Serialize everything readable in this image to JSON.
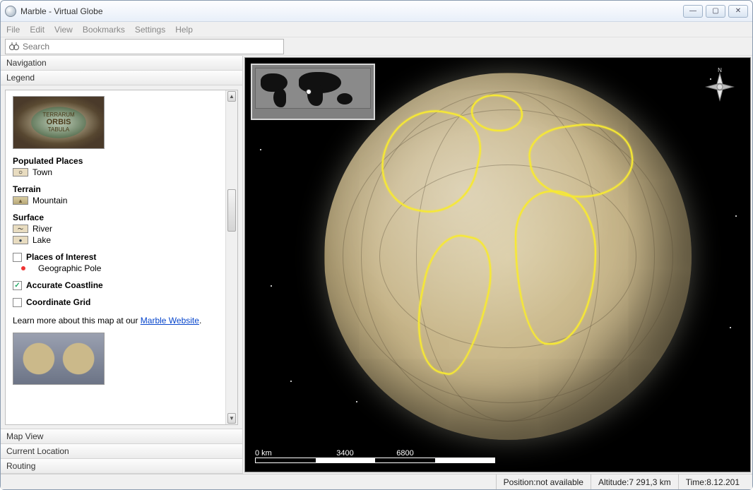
{
  "window": {
    "title": "Marble - Virtual Globe"
  },
  "menu": {
    "file": "File",
    "edit": "Edit",
    "view": "View",
    "bookmarks": "Bookmarks",
    "settings": "Settings",
    "help": "Help"
  },
  "search": {
    "placeholder": "Search"
  },
  "sidebar": {
    "tabs": {
      "navigation": "Navigation",
      "legend": "Legend",
      "mapview": "Map View",
      "currentlocation": "Current Location",
      "routing": "Routing"
    }
  },
  "legend": {
    "cartouche": {
      "line1": "TERRARUM",
      "line2": "ORBIS",
      "line3": "TABULA"
    },
    "sections": {
      "populated": {
        "title": "Populated Places",
        "town": "Town"
      },
      "terrain": {
        "title": "Terrain",
        "mountain": "Mountain"
      },
      "surface": {
        "title": "Surface",
        "river": "River",
        "lake": "Lake"
      }
    },
    "checks": {
      "poi": {
        "label": "Places of Interest",
        "checked": false,
        "sub": "Geographic Pole"
      },
      "coastline": {
        "label": "Accurate Coastline",
        "checked": true
      },
      "grid": {
        "label": "Coordinate Grid",
        "checked": false
      }
    },
    "learn": {
      "prefix": "Learn more about this map at our ",
      "link": "Marble Website",
      "suffix": "."
    }
  },
  "compass": {
    "n": "N"
  },
  "scale": {
    "t0": "0 km",
    "t1": "3400",
    "t2": "6800"
  },
  "status": {
    "position_label": "Position: ",
    "position_value": "not available",
    "altitude_label": "Altitude: ",
    "altitude_value": "7 291,3 km",
    "time_label": "Time: ",
    "time_value": "8.12.201"
  }
}
